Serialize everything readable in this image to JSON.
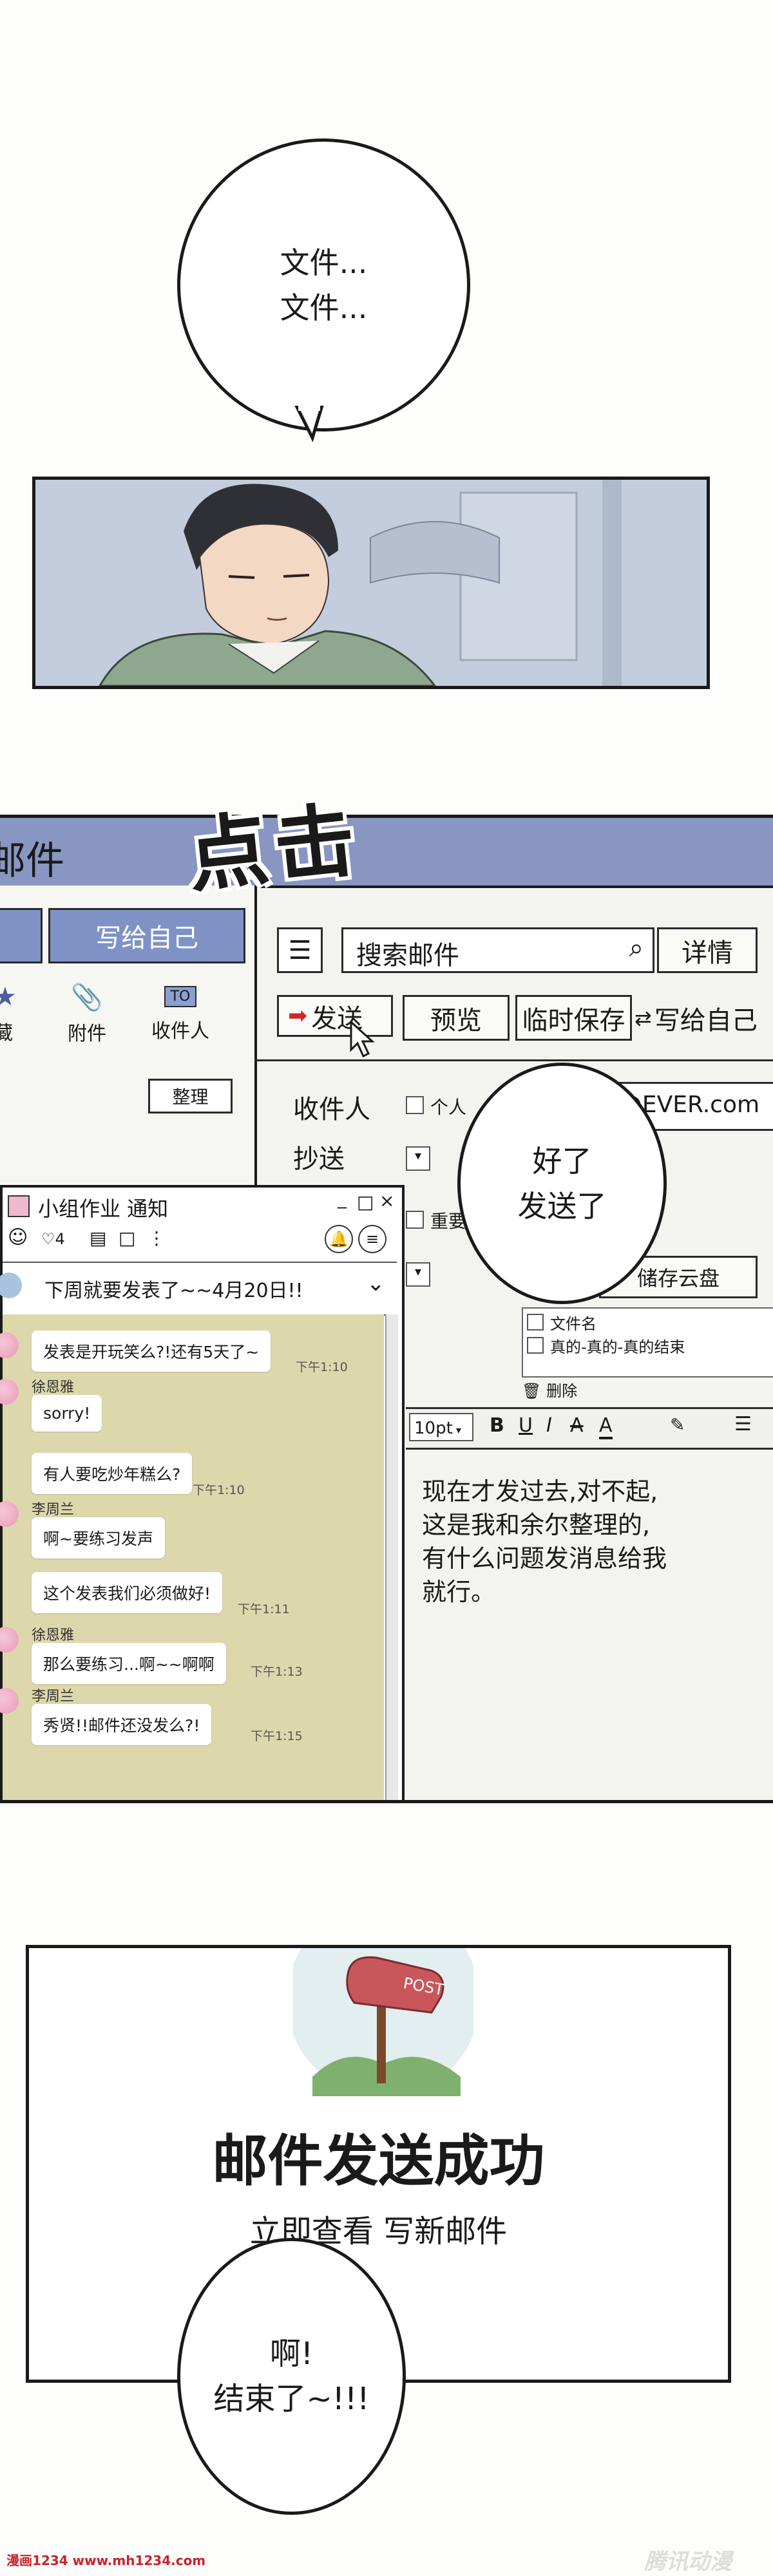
{
  "top_bubble": {
    "text": "文件...\n文件..."
  },
  "sfx": {
    "text": "点击"
  },
  "mail": {
    "title": "邮件",
    "sidebar": {
      "write_self_btn": "写给自己",
      "items": [
        {
          "label": "藏",
          "icon": "star-icon"
        },
        {
          "label": "附件",
          "icon": "paperclip-icon"
        },
        {
          "label": "收件人",
          "icon": "to-icon",
          "icon_text": "TO"
        }
      ],
      "organize_btn": "整理"
    },
    "search": {
      "placeholder": "搜索邮件",
      "detail_btn": "详情"
    },
    "toolbar": {
      "send": "发送",
      "preview": "预览",
      "save_draft": "临时保存",
      "write_self": "写给自己"
    },
    "form": {
      "to_label": "收件人",
      "to_option": "个人",
      "to_value": "d@EVER.com",
      "cc_label": "抄送",
      "important_label": "重要",
      "cloud_btn": "储存云盘",
      "attachments_header": "文件名",
      "attachments": [
        "真的-真的-真的结束"
      ],
      "delete_label": "删除"
    },
    "editor": {
      "font_size": "10pt",
      "format_buttons": [
        "B",
        "U",
        "I",
        "A",
        "A"
      ],
      "body": "现在才发过去,对不起,\n这是我和余尔整理的,\n有什么问题发消息给我\n就行。"
    },
    "bubble": {
      "text": "好了\n发送了"
    }
  },
  "chat": {
    "title": "小组作业 通知",
    "member_count": "4",
    "window_controls": [
      "_",
      "□",
      "×"
    ],
    "announcement": "下周就要发表了~~4月20日!!",
    "messages": [
      {
        "name": "",
        "text": "发表是开玩笑么?!还有5天了~",
        "time": "下午1:10"
      },
      {
        "name": "徐恩雅",
        "text": "sorry!",
        "time": ""
      },
      {
        "name": "",
        "text": "有人要吃炒年糕么?",
        "time": "下午1:10"
      },
      {
        "name": "李周兰",
        "text": "啊~要练习发声",
        "time": ""
      },
      {
        "name": "",
        "text": "这个发表我们必须做好!",
        "time": "下午1:11"
      },
      {
        "name": "徐恩雅",
        "text": "那么要练习...啊~~啊啊",
        "time": "下午1:13"
      },
      {
        "name": "李周兰",
        "text": "秀贤!!邮件还没发么?!",
        "time": "下午1:15"
      }
    ]
  },
  "success": {
    "post_sign": "POST",
    "title": "邮件发送成功",
    "links": [
      "立即查看",
      "写新邮件"
    ]
  },
  "bottom_bubble": {
    "text": "啊!\n结束了~!!!"
  },
  "watermarks": {
    "left": "漫画1234 www.mh1234.com",
    "right": "腾讯动漫"
  }
}
